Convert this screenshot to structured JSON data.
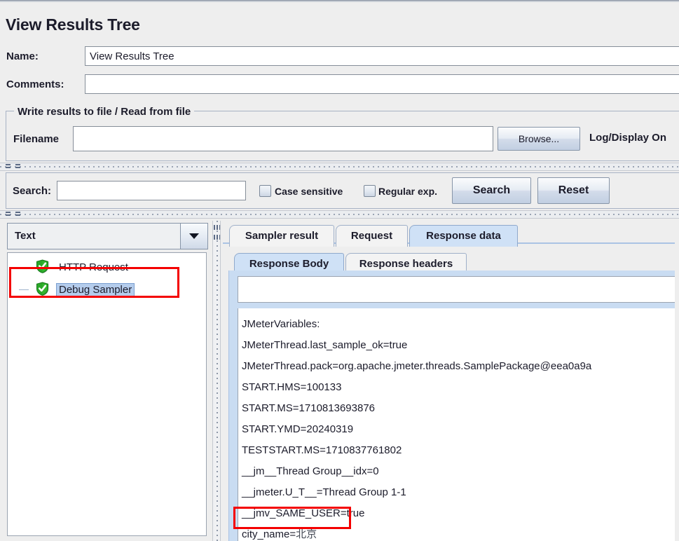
{
  "window": {
    "title": "View Results Tree"
  },
  "form": {
    "name_label": "Name:",
    "name_value": "View Results Tree",
    "comments_label": "Comments:",
    "comments_value": "",
    "comments_placeholder": ""
  },
  "file_group": {
    "title": "Write results to file / Read from file",
    "filename_label": "Filename",
    "filename_value": "",
    "browse_label": "Browse...",
    "log_display_label": "Log/Display On"
  },
  "search_bar": {
    "search_label": "Search:",
    "search_value": "",
    "case_sensitive_label": "Case sensitive",
    "case_sensitive_checked": false,
    "regular_exp_label": "Regular exp.",
    "regular_exp_checked": false,
    "search_button": "Search",
    "reset_button": "Reset"
  },
  "left_panel": {
    "renderer_selected": "Text",
    "tree_nodes": [
      {
        "label": "HTTP Request",
        "icon": "green-shield-check-icon",
        "selected": false
      },
      {
        "label": "Debug Sampler",
        "icon": "green-shield-check-icon",
        "selected": true
      }
    ]
  },
  "right_panel": {
    "tabs": [
      {
        "label": "Sampler result",
        "active": false
      },
      {
        "label": "Request",
        "active": false
      },
      {
        "label": "Response data",
        "active": true
      }
    ],
    "subtabs": [
      {
        "label": "Response Body",
        "active": true
      },
      {
        "label": "Response headers",
        "active": false
      }
    ],
    "filter_value": "",
    "response_lines": [
      "JMeterVariables:",
      "JMeterThread.last_sample_ok=true",
      "JMeterThread.pack=org.apache.jmeter.threads.SamplePackage@eea0a9a",
      "START.HMS=100133",
      "START.MS=1710813693876",
      "START.YMD=20240319",
      "TESTSTART.MS=1710837761802",
      "__jm__Thread Group__idx=0",
      "__jmeter.U_T__=Thread Group 1-1",
      "__jmv_SAME_USER=true",
      "city_name=北京"
    ]
  },
  "annotations": {
    "highlight_color": "#f40000",
    "boxes": [
      {
        "name": "debug-sampler-node"
      },
      {
        "name": "city-name-variable"
      }
    ]
  },
  "colors": {
    "background": "#eeeeee",
    "active_tab": "#cfe1f6",
    "selection": "#b4ccec",
    "annotation_red": "#f40000",
    "shield_green": "#2aa828"
  }
}
